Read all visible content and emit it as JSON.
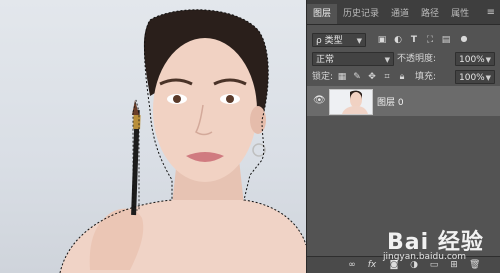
{
  "tabs": [
    {
      "label": "图层",
      "active": true
    },
    {
      "label": "历史记录",
      "active": false
    },
    {
      "label": "通道",
      "active": false
    },
    {
      "label": "路径",
      "active": false
    },
    {
      "label": "属性",
      "active": false
    }
  ],
  "filter": {
    "kind_label": "ρ 类型"
  },
  "blend": {
    "mode": "正常",
    "opacity_label": "不透明度:",
    "opacity_value": "100%"
  },
  "lock": {
    "label": "锁定:",
    "fill_label": "填充:",
    "fill_value": "100%"
  },
  "layer": {
    "name": "图层 0",
    "visible": true
  },
  "watermark": {
    "text": "Bai  经验",
    "url": "jingyan.baidu.com"
  },
  "colors": {
    "panel": "#535353",
    "tab_bar": "#3e3e3e",
    "selected_layer": "#6b6b6b",
    "canvas_bg": "#dfe3e8"
  },
  "icons": [
    "eye-icon",
    "panel-menu-icon",
    "filter-pixel-icon",
    "filter-adjust-icon",
    "filter-type-icon",
    "filter-shape-icon",
    "filter-smart-icon",
    "filter-toggle-icon",
    "lock-pixels-icon",
    "lock-paint-icon",
    "lock-move-icon",
    "lock-artboard-icon",
    "lock-all-icon",
    "link-icon",
    "fx-icon",
    "mask-icon",
    "adjustment-icon",
    "group-icon",
    "new-layer-icon",
    "trash-icon"
  ]
}
